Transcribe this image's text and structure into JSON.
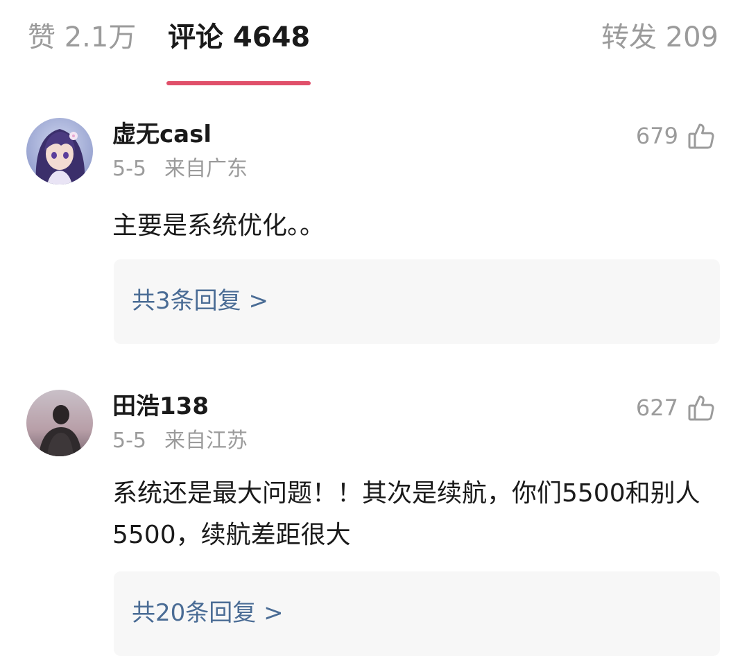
{
  "tabs": {
    "likes": "赞 2.1万",
    "comments": "评论 4648",
    "reposts": "转发 209",
    "accent_color": "#e0506a"
  },
  "comments": [
    {
      "username": "虚无casl",
      "date": "5-5",
      "location": "来自广东",
      "likes": "679",
      "text": "主要是系统优化。。",
      "replies": "共3条回复 >",
      "avatar_icon": "anime-girl-avatar"
    },
    {
      "username": "田浩138",
      "date": "5-5",
      "location": "来自江苏",
      "likes": "627",
      "text": "系统还是最大问题！！其次是续航，你们5500和别人5500，续航差距很大",
      "replies": "共20条回复 >",
      "avatar_icon": "silhouette-avatar"
    }
  ]
}
